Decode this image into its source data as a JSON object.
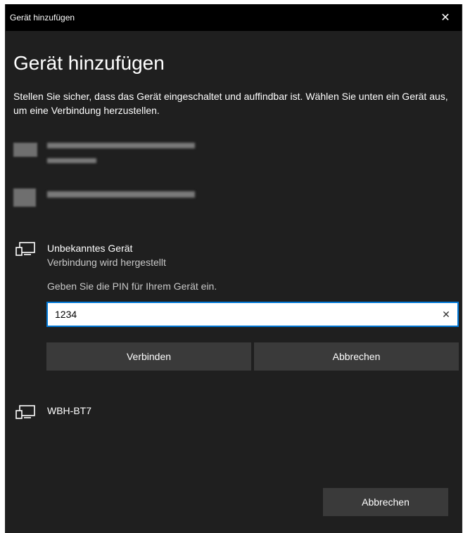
{
  "window": {
    "title": "Gerät hinzufügen",
    "close_glyph": "✕"
  },
  "main": {
    "heading": "Gerät hinzufügen",
    "description": "Stellen Sie sicher, dass das Gerät eingeschaltet und auffindbar ist. Wählen Sie unten ein Gerät aus, um eine Verbindung herzustellen."
  },
  "devices": [
    {
      "name": "Unbekanntes Gerät",
      "status": "Verbindung wird hergestellt",
      "icon": "device-icon"
    },
    {
      "name": "WBH-BT7",
      "icon": "device-icon"
    }
  ],
  "pin": {
    "prompt": "Geben Sie die PIN für Ihrem Gerät ein.",
    "value": "1234",
    "clear_glyph": "✕",
    "connect_label": "Verbinden",
    "cancel_label": "Abbrechen"
  },
  "footer": {
    "cancel_label": "Abbrechen"
  },
  "colors": {
    "background": "#1f1f1f",
    "titlebar": "#000000",
    "accent": "#0078d7",
    "button": "#3a3a3a"
  }
}
